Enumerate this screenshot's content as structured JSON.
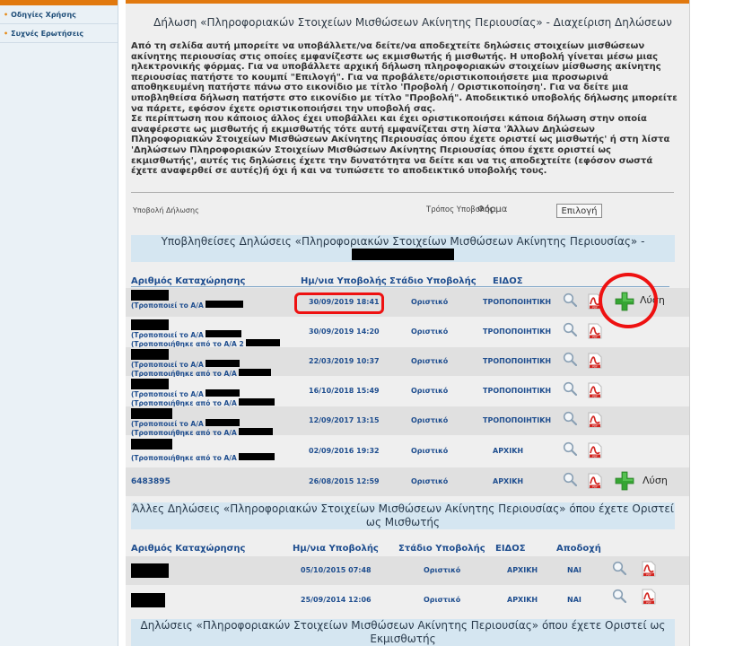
{
  "sidebar": {
    "items": [
      {
        "label": "Οδηγίες Χρήσης"
      },
      {
        "label": "Συχνές Ερωτήσεις"
      }
    ]
  },
  "page": {
    "title": "Δήλωση «Πληροφοριακών Στοιχείων Μισθώσεων Ακίνητης Περιουσίας» - Διαχείριση Δηλώσεων",
    "intro_p1": "Από τη σελίδα αυτή μπορείτε να υποβάλλετε/να δείτε/να αποδεχτείτε δηλώσεις στοιχείων μισθώσεων ακίνητης περιουσίας στις οποίες εμφανίζεστε ως εκμισθωτής ή μισθωτής. Η υποβολή γίνεται μέσω μιας ηλεκτρονικής φόρμας. Για να υποβάλλετε αρχική δήλωση πληροφοριακών στοιχείων μίσθωσης ακίνητης περιουσίας πατήστε το κουμπί \"Επιλογή\". Για να προβάλετε/οριστικοποιήσετε μια προσωρινά αποθηκευμένη πατήστε πάνω στο εικονίδιο με τίτλο 'Προβολή / Οριστικοποίηση'. Για να δείτε μια υποβληθείσα δήλωση πατήστε στο εικονίδιο με τίτλο \"Προβολή\". Αποδεικτικό υποβολής δήλωσης μπορείτε να πάρετε, εφόσον έχετε οριστικοποιήσει την υποβολή σας.",
    "intro_p2": "Σε περίπτωση που κάποιος άλλος έχει υποβάλλει και έχει οριστικοποιήσει κάποια δήλωση στην οποία αναφέρεστε ως μισθωτής ή εκμισθωτής τότε αυτή εμφανίζεται στη λίστα 'Άλλων Δηλώσεων Πληροφοριακών Στοιχείων Μισθώσεων Ακίνητης Περιουσίας όπου έχετε οριστεί ως μισθωτής' ή στη λίστα 'Δηλώσεων Πληροφοριακών Στοιχείων Μισθώσεων Ακίνητης Περιουσίας όπου έχετε οριστεί ως εκμισθωτής', αυτές τις δηλώσεις έχετε την δυνατότητα να δείτε και να τις αποδεχτείτε (εφόσον σωστά έχετε αναφερθεί σε αυτές)ή όχι ή και να τυπώσετε το αποδεικτικό υποβολής τους.",
    "submit_label": "Υποβολή Δήλωσης",
    "mode_label": "Τρόπος Υποβολής:",
    "mode_value": "Φόρμα",
    "select_button": "Επιλογή"
  },
  "section1": {
    "title": "Υποβληθείσες Δηλώσεις «Πληροφοριακών Στοιχείων Μισθώσεων Ακίνητης Περιουσίας» -",
    "headers": {
      "id": "Αριθμός Καταχώρησης",
      "date": "Ημ/νια Υποβολής",
      "stage": "Στάδιο Υποβολής",
      "kind": "ΕΙΔΟΣ"
    },
    "rows": [
      {
        "line1": "(Τροποποιεί το Α/Α",
        "line2": "",
        "date": "30/09/2019 18:41",
        "stage": "Οριστικό",
        "kind": "ΤΡΟΠΟΠΟΙΗΤΙΚΗ",
        "action": "Λύση"
      },
      {
        "line1": "(Τροποποιεί το Α/Α",
        "line2": "(Τροποποιήθηκε από το Α/Α 2",
        "date": "30/09/2019 14:20",
        "stage": "Οριστικό",
        "kind": "ΤΡΟΠΟΠΟΙΗΤΙΚΗ",
        "action": ""
      },
      {
        "line1": "(Τροποποιεί το Α/Α",
        "line2": "(Τροποποιήθηκε από το Α/Α",
        "date": "22/03/2019 10:37",
        "stage": "Οριστικό",
        "kind": "ΤΡΟΠΟΠΟΙΗΤΙΚΗ",
        "action": ""
      },
      {
        "line1": "(Τροποποιεί το Α/Α",
        "line2": "(Τροποποιήθηκε από το Α/Α",
        "date": "16/10/2018 15:49",
        "stage": "Οριστικό",
        "kind": "ΤΡΟΠΟΠΟΙΗΤΙΚΗ",
        "action": ""
      },
      {
        "line1": "(Τροποποιεί το Α/Α",
        "line2": "(Τροποποιήθηκε από το Α/Α",
        "date": "12/09/2017 13:15",
        "stage": "Οριστικό",
        "kind": "ΤΡΟΠΟΠΟΙΗΤΙΚΗ",
        "action": ""
      },
      {
        "line1": "(Τροποποιήθηκε από το Α/Α",
        "line2": "",
        "date": "02/09/2016 19:32",
        "stage": "Οριστικό",
        "kind": "ΑΡΧΙΚΗ",
        "action": ""
      },
      {
        "id": "6483895",
        "date": "26/08/2015 12:59",
        "stage": "Οριστικό",
        "kind": "ΑΡΧΙΚΗ",
        "action": "Λύση"
      }
    ]
  },
  "section2": {
    "title": "Άλλες Δηλώσεις «Πληροφοριακών Στοιχείων Μισθώσεων Ακίνητης Περιουσίας» όπου έχετε Οριστεί ως Μισθωτής",
    "headers": {
      "id": "Αριθμός Καταχώρησης",
      "date": "Ημ/νια Υποβολής",
      "stage": "Στάδιο Υποβολής",
      "kind": "ΕΙΔΟΣ",
      "accept": "Αποδοχή"
    },
    "rows": [
      {
        "date": "05/10/2015 07:48",
        "stage": "Οριστικό",
        "kind": "ΑΡΧΙΚΗ",
        "accept": "ΝΑΙ"
      },
      {
        "date": "25/09/2014 12:06",
        "stage": "Οριστικό",
        "kind": "ΑΡΧΙΚΗ",
        "accept": "ΝΑΙ"
      }
    ]
  },
  "section3": {
    "title": "Δηλώσεις «Πληροφοριακών Στοιχείων Μισθώσεων Ακίνητης Περιουσίας» όπου έχετε Οριστεί ως Εκμισθωτής"
  }
}
